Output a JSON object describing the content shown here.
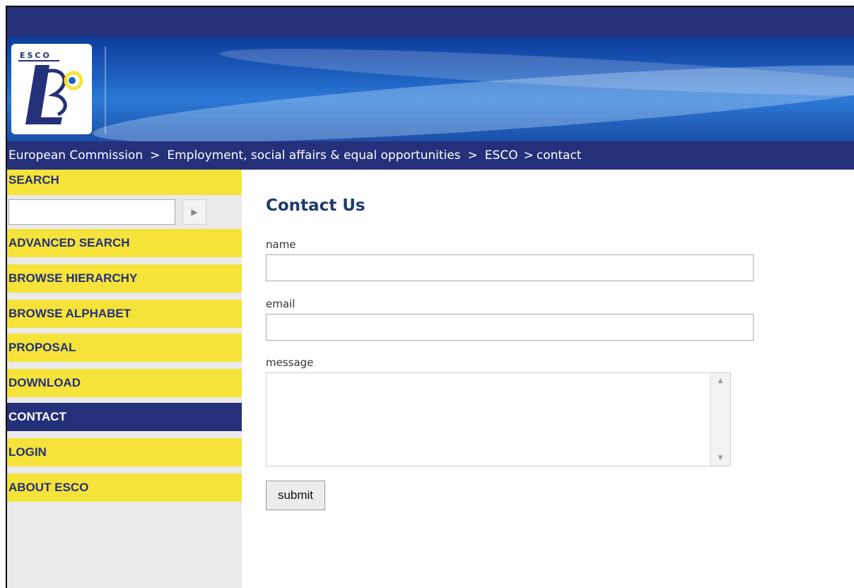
{
  "logo": {
    "text": "ESCO"
  },
  "breadcrumb": {
    "items": [
      "European Commission",
      "Employment, social affairs & equal opportunities",
      "ESCO",
      "contact"
    ],
    "separator": ">"
  },
  "sidebar": {
    "search_label": "SEARCH",
    "search_input": {
      "value": "",
      "placeholder": ""
    },
    "search_button_icon": "play-arrow-icon",
    "items": [
      {
        "label": "ADVANCED SEARCH",
        "active": false
      },
      {
        "label": "BROWSE HIERARCHY",
        "active": false
      },
      {
        "label": "BROWSE ALPHABET",
        "active": false
      },
      {
        "label": "PROPOSAL",
        "active": false
      },
      {
        "label": "DOWNLOAD",
        "active": false
      },
      {
        "label": "CONTACT",
        "active": true
      },
      {
        "label": "LOGIN",
        "active": false
      },
      {
        "label": "ABOUT ESCO",
        "active": false
      }
    ]
  },
  "form": {
    "title": "Contact Us",
    "name_label": "name",
    "name_value": "",
    "email_label": "email",
    "email_value": "",
    "message_label": "message",
    "message_value": "",
    "submit_label": "submit"
  },
  "colors": {
    "navy": "#25307a",
    "nav_yellow": "#f5e33a",
    "sidebar_gray": "#eaeaea",
    "title_blue": "#1d3a6a"
  }
}
